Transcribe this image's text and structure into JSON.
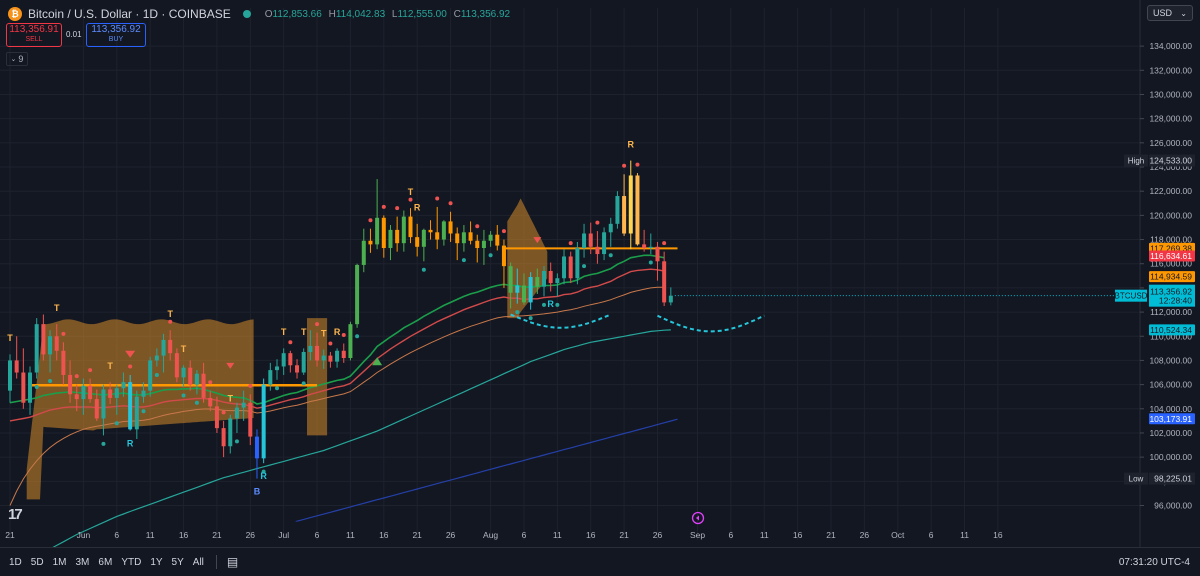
{
  "header": {
    "symbol_title": "Bitcoin / U.S. Dollar · 1D · COINBASE",
    "coin_glyph": "₿",
    "ohlc": [
      {
        "k": "O",
        "v": "112,853.66"
      },
      {
        "k": "H",
        "v": "114,042.83"
      },
      {
        "k": "L",
        "v": "112,555.00"
      },
      {
        "k": "C",
        "v": "113,356.92"
      }
    ]
  },
  "trade": {
    "sell_price": "113,356.91",
    "sell_label": "SELL",
    "spread": "0.01",
    "buy_price": "113,356.92",
    "buy_label": "BUY"
  },
  "indicator_toggle": "9",
  "currency": "USD",
  "axis_badges": [
    {
      "text": "117,269.38",
      "value": 117269.38,
      "bg": "#ff9800",
      "fg": "#131722"
    },
    {
      "text": "116,634.61",
      "value": 116634.61,
      "bg": "#f23645",
      "fg": "#ffffff"
    },
    {
      "text": "114,934.59",
      "value": 114934.59,
      "bg": "#ff9800",
      "fg": "#131722"
    },
    {
      "text": "110,524.34",
      "value": 110524.34,
      "bg": "#00bcd4",
      "fg": "#131722"
    },
    {
      "text": "103,173.91",
      "value": 103173.91,
      "bg": "#2962ff",
      "fg": "#ffffff"
    }
  ],
  "last_price": {
    "symbol": "BTCUSD",
    "price": "113,356.92",
    "countdown": "12:28:40",
    "value": 113356.92
  },
  "high_marker": {
    "label": "High",
    "text": "124,533.00",
    "value": 124533
  },
  "low_marker": {
    "label": "Low",
    "text": "98,225.01",
    "value": 98225.01
  },
  "bottom": {
    "ranges": [
      "1D",
      "5D",
      "1M",
      "3M",
      "6M",
      "YTD",
      "1Y",
      "5Y",
      "All"
    ],
    "time": "07:31:20 UTC-4"
  },
  "markers": [
    {
      "t": "T",
      "i": 0,
      "above": true,
      "color": "#ffb74d"
    },
    {
      "t": "T",
      "i": 7,
      "above": true,
      "color": "#ffb74d"
    },
    {
      "t": "T",
      "i": 15,
      "above": true,
      "color": "#ffb74d"
    },
    {
      "t": "T",
      "i": 24,
      "above": true,
      "color": "#ffb74d"
    },
    {
      "t": "T",
      "i": 26,
      "above": true,
      "color": "#ffb74d"
    },
    {
      "t": "T",
      "i": 33,
      "above": true,
      "color": "#ffb74d"
    },
    {
      "t": "R",
      "i": 18,
      "above": false,
      "color": "#26c6da"
    },
    {
      "t": "B",
      "i": 37,
      "above": false,
      "color": "#5b8cff"
    },
    {
      "t": "R",
      "i": 38,
      "above": false,
      "color": "#26c6da"
    },
    {
      "t": "T",
      "i": 41,
      "above": true,
      "color": "#ffb74d"
    },
    {
      "t": "T",
      "i": 44,
      "above": true,
      "color": "#ffb74d"
    },
    {
      "t": "T",
      "i": 47,
      "above": true,
      "color": "#ffb74d"
    },
    {
      "t": "R",
      "i": 49,
      "above": true,
      "color": "#ffb74d"
    },
    {
      "t": "T",
      "i": 60,
      "above": true,
      "color": "#ffb74d"
    },
    {
      "t": "R",
      "i": 61,
      "above": true,
      "color": "#ffb74d"
    },
    {
      "t": "R",
      "i": 81,
      "above": false,
      "color": "#26c6da"
    },
    {
      "t": "R",
      "i": 93,
      "above": true,
      "color": "#ffb74d"
    }
  ],
  "chart_data": {
    "type": "candlestick",
    "y_axis": {
      "ticks": [
        96000,
        98000,
        100000,
        102000,
        104000,
        106000,
        108000,
        110000,
        112000,
        114000,
        116000,
        118000,
        120000,
        122000,
        124000,
        126000,
        128000,
        130000,
        132000,
        134000
      ],
      "tick_labels": [
        "96,000.00",
        "98,000.00",
        "100,000.00",
        "102,000.00",
        "104,000.00",
        "106,000.00",
        "108,000.00",
        "110,000.00",
        "112,000.00",
        "114,000.00",
        "116,000.00",
        "118,000.00",
        "120,000.00",
        "122,000.00",
        "124,000.00",
        "126,000.00",
        "128,000.00",
        "130,000.00",
        "132,000.00",
        "134,000.00"
      ],
      "range": [
        94800,
        135500
      ]
    },
    "x_axis": {
      "labels": [
        {
          "t": "21",
          "d": 0
        },
        {
          "t": "Jun",
          "d": 11
        },
        {
          "t": "6",
          "d": 16
        },
        {
          "t": "11",
          "d": 21
        },
        {
          "t": "16",
          "d": 26
        },
        {
          "t": "21",
          "d": 31
        },
        {
          "t": "26",
          "d": 36
        },
        {
          "t": "Jul",
          "d": 41
        },
        {
          "t": "6",
          "d": 46
        },
        {
          "t": "11",
          "d": 51
        },
        {
          "t": "16",
          "d": 56
        },
        {
          "t": "21",
          "d": 61
        },
        {
          "t": "26",
          "d": 66
        },
        {
          "t": "Aug",
          "d": 72
        },
        {
          "t": "6",
          "d": 77
        },
        {
          "t": "11",
          "d": 82
        },
        {
          "t": "16",
          "d": 87
        },
        {
          "t": "21",
          "d": 92
        },
        {
          "t": "26",
          "d": 97
        },
        {
          "t": "Sep",
          "d": 103
        },
        {
          "t": "6",
          "d": 108
        },
        {
          "t": "11",
          "d": 113
        },
        {
          "t": "16",
          "d": 118
        },
        {
          "t": "21",
          "d": 123
        },
        {
          "t": "26",
          "d": 128
        },
        {
          "t": "Oct",
          "d": 133
        },
        {
          "t": "6",
          "d": 138
        },
        {
          "t": "11",
          "d": 143
        },
        {
          "t": "16",
          "d": 148
        }
      ]
    },
    "candles": [
      [
        105500,
        108500,
        104500,
        108000
      ],
      [
        108000,
        110000,
        106500,
        107000
      ],
      [
        107000,
        109000,
        104000,
        104500
      ],
      [
        104500,
        107500,
        103500,
        107000
      ],
      [
        107000,
        111500,
        106500,
        111000
      ],
      [
        111000,
        111800,
        108000,
        108500
      ],
      [
        108500,
        110500,
        107000,
        110000
      ],
      [
        110000,
        111000,
        108000,
        108800
      ],
      [
        108800,
        109500,
        106000,
        106800
      ],
      [
        106800,
        108000,
        104500,
        105200
      ],
      [
        105200,
        106000,
        103800,
        104800
      ],
      [
        104800,
        106500,
        103500,
        105900
      ],
      [
        105900,
        106500,
        104500,
        104800
      ],
      [
        104800,
        105600,
        103000,
        103200
      ],
      [
        103200,
        106000,
        101800,
        105600
      ],
      [
        105600,
        106200,
        104400,
        104900
      ],
      [
        104900,
        106000,
        103500,
        105700
      ],
      [
        105700,
        107000,
        105000,
        106200
      ],
      [
        106200,
        106800,
        102200,
        102300
      ],
      [
        102300,
        105500,
        101500,
        105000
      ],
      [
        105000,
        106200,
        104500,
        105500
      ],
      [
        105500,
        108300,
        105000,
        108000
      ],
      [
        108000,
        109000,
        107500,
        108400
      ],
      [
        108400,
        110200,
        107000,
        109700
      ],
      [
        109700,
        110500,
        108000,
        108600
      ],
      [
        108600,
        109000,
        106200,
        106600
      ],
      [
        106600,
        107600,
        105800,
        107400
      ],
      [
        107400,
        108000,
        105500,
        106000
      ],
      [
        106000,
        107200,
        105200,
        106900
      ],
      [
        106900,
        107800,
        104500,
        104900
      ],
      [
        104900,
        105500,
        103800,
        104200
      ],
      [
        104200,
        105000,
        102000,
        102400
      ],
      [
        102400,
        103000,
        100000,
        100900
      ],
      [
        100900,
        103500,
        100300,
        103200
      ],
      [
        103200,
        104500,
        102000,
        104100
      ],
      [
        104100,
        105500,
        103000,
        104500
      ],
      [
        104500,
        105200,
        101000,
        101700
      ],
      [
        101700,
        102300,
        98225,
        99900
      ],
      [
        99900,
        106500,
        99500,
        106000
      ],
      [
        106000,
        107800,
        105500,
        107200
      ],
      [
        107200,
        108100,
        106400,
        107500
      ],
      [
        107500,
        109000,
        106800,
        108600
      ],
      [
        108600,
        108800,
        107000,
        107600
      ],
      [
        107600,
        108100,
        106500,
        107000
      ],
      [
        107000,
        109000,
        106800,
        108700
      ],
      [
        108700,
        110500,
        108000,
        109200
      ],
      [
        109200,
        110300,
        107500,
        108000
      ],
      [
        108000,
        108900,
        107300,
        108400
      ],
      [
        108400,
        108700,
        107400,
        107900
      ],
      [
        107900,
        109000,
        107400,
        108800
      ],
      [
        108800,
        109400,
        107800,
        108200
      ],
      [
        108200,
        111200,
        108000,
        111000
      ],
      [
        111000,
        116000,
        110700,
        115900
      ],
      [
        115900,
        118900,
        115300,
        117900
      ],
      [
        117900,
        118900,
        116900,
        117600
      ],
      [
        117600,
        123000,
        117200,
        119800
      ],
      [
        119800,
        120000,
        116500,
        117300
      ],
      [
        117300,
        119200,
        116300,
        118800
      ],
      [
        118800,
        119900,
        117000,
        117700
      ],
      [
        117700,
        120400,
        117000,
        119900
      ],
      [
        119900,
        120600,
        117700,
        118200
      ],
      [
        118200,
        119300,
        116600,
        117400
      ],
      [
        117400,
        118900,
        116200,
        118800
      ],
      [
        118800,
        119600,
        118000,
        118600
      ],
      [
        118600,
        120700,
        117200,
        118000
      ],
      [
        118000,
        119600,
        117500,
        119500
      ],
      [
        119500,
        120300,
        117800,
        118500
      ],
      [
        118500,
        119000,
        116300,
        117700
      ],
      [
        117700,
        119200,
        117000,
        118600
      ],
      [
        118600,
        119500,
        117600,
        117900
      ],
      [
        117900,
        118400,
        116100,
        117300
      ],
      [
        117300,
        118800,
        115900,
        117900
      ],
      [
        117900,
        118700,
        117400,
        118400
      ],
      [
        118400,
        119200,
        117100,
        117500
      ],
      [
        117500,
        118000,
        114000,
        115800
      ],
      [
        115800,
        116100,
        112300,
        113600
      ],
      [
        113600,
        115600,
        112700,
        114200
      ],
      [
        114200,
        115200,
        112600,
        112800
      ],
      [
        112800,
        115300,
        112200,
        114900
      ],
      [
        114900,
        115600,
        113500,
        114100
      ],
      [
        114100,
        115800,
        113300,
        115400
      ],
      [
        115400,
        116100,
        113700,
        114400
      ],
      [
        114400,
        115200,
        113300,
        114800
      ],
      [
        114800,
        117200,
        114300,
        116600
      ],
      [
        116600,
        117000,
        114400,
        114800
      ],
      [
        114800,
        117800,
        114300,
        117300
      ],
      [
        117300,
        119300,
        116500,
        118500
      ],
      [
        118500,
        119400,
        116800,
        117400
      ],
      [
        117400,
        118700,
        116000,
        116800
      ],
      [
        116800,
        119000,
        116300,
        118600
      ],
      [
        118600,
        119800,
        117400,
        119300
      ],
      [
        119300,
        122000,
        118900,
        121600
      ],
      [
        121600,
        123400,
        118300,
        118500
      ],
      [
        118500,
        124533,
        117200,
        123300
      ],
      [
        123300,
        123500,
        117500,
        117600
      ],
      [
        117600,
        118800,
        117000,
        117300
      ],
      [
        117300,
        118500,
        116800,
        117400
      ],
      [
        117400,
        117800,
        114600,
        116200
      ],
      [
        116200,
        117000,
        112500,
        112800
      ],
      [
        112800,
        114042,
        112555,
        113356
      ]
    ],
    "ema_green": [
      104500,
      104600,
      104700,
      104800,
      104900,
      105100,
      105200,
      105300,
      105350,
      105400,
      105350,
      105300,
      105250,
      105200,
      105150,
      105200,
      105250,
      105300,
      105200,
      105150,
      105150,
      105250,
      105400,
      105550,
      105600,
      105600,
      105650,
      105650,
      105700,
      105600,
      105450,
      105300,
      105100,
      105000,
      104950,
      104900,
      104700,
      104400,
      104500,
      104700,
      104900,
      105100,
      105250,
      105350,
      105550,
      105750,
      105900,
      106050,
      106200,
      106350,
      106450,
      106700,
      107300,
      107900,
      108450,
      109150,
      109550,
      109950,
      110300,
      110700,
      111000,
      111300,
      111650,
      111950,
      112250,
      112550,
      112800,
      113050,
      113300,
      113500,
      113650,
      113850,
      114050,
      114200,
      114300,
      114200,
      114200,
      114050,
      114100,
      114100,
      114200,
      114200,
      114250,
      114450,
      114500,
      114650,
      114950,
      115100,
      115200,
      115400,
      115600,
      115950,
      116200,
      116500,
      116600,
      116700,
      116700,
      116600,
      116500
    ],
    "ema_red": [
      103000,
      103100,
      103200,
      103300,
      103500,
      103700,
      103900,
      104000,
      104100,
      104150,
      104150,
      104150,
      104150,
      104100,
      104100,
      104150,
      104200,
      104250,
      104200,
      104150,
      104150,
      104250,
      104400,
      104550,
      104650,
      104700,
      104750,
      104800,
      104850,
      104850,
      104800,
      104700,
      104550,
      104450,
      104400,
      104350,
      104250,
      104050,
      104150,
      104300,
      104450,
      104600,
      104750,
      104850,
      105000,
      105200,
      105350,
      105500,
      105650,
      105800,
      105900,
      106100,
      106600,
      107100,
      107600,
      108150,
      108550,
      108950,
      109300,
      109650,
      110000,
      110300,
      110600,
      110900,
      111200,
      111450,
      111700,
      111950,
      112200,
      112400,
      112600,
      112800,
      113000,
      113150,
      113250,
      113150,
      113150,
      113050,
      113100,
      113100,
      113200,
      113250,
      113300,
      113450,
      113500,
      113650,
      113900,
      114050,
      114150,
      114350,
      114550,
      114850,
      115100,
      115350,
      115450,
      115500,
      115550,
      115500,
      115400
    ],
    "ema_orange": [
      96000,
      97200,
      98200,
      99000,
      99700,
      100300,
      100800,
      101200,
      101550,
      101850,
      102100,
      102300,
      102450,
      102550,
      102650,
      102750,
      102850,
      102950,
      102980,
      103000,
      103050,
      103150,
      103300,
      103450,
      103580,
      103680,
      103780,
      103860,
      103940,
      103980,
      103980,
      103950,
      103880,
      103850,
      103850,
      103850,
      103800,
      103650,
      103720,
      103820,
      103950,
      104080,
      104200,
      104300,
      104440,
      104600,
      104720,
      104850,
      104980,
      105110,
      105230,
      105420,
      105800,
      106200,
      106580,
      107000,
      107350,
      107700,
      108020,
      108340,
      108640,
      108920,
      109180,
      109450,
      109700,
      109950,
      110180,
      110400,
      110620,
      110820,
      111000,
      111180,
      111360,
      111520,
      111620,
      111640,
      111670,
      111690,
      111740,
      111790,
      111850,
      111920,
      112000,
      112110,
      112200,
      112320,
      112480,
      112610,
      112730,
      112870,
      113020,
      113230,
      113420,
      113630,
      113770,
      113890,
      114000,
      114050,
      114060
    ],
    "ma_cyan": [
      91800,
      92100,
      92400,
      92700,
      93000,
      93300,
      93600,
      93850,
      94100,
      94350,
      94600,
      94850,
      95100,
      95300,
      95500,
      95700,
      95900,
      96100,
      96300,
      96500,
      96700,
      96900,
      97100,
      97300,
      97500,
      97700,
      97900,
      98100,
      98300,
      98450,
      98600,
      98750,
      98900,
      99050,
      99200,
      99350,
      99500,
      99650,
      99800,
      99950,
      100100,
      100250,
      100400,
      100550,
      100750,
      100950,
      101150,
      101350,
      101550,
      101750,
      101950,
      102150,
      102400,
      102650,
      102900,
      103150,
      103400,
      103650,
      103900,
      104150,
      104400,
      104650,
      104900,
      105150,
      105400,
      105650,
      105900,
      106150,
      106400,
      106650,
      106900,
      107150,
      107400,
      107650,
      107900,
      108100,
      108300,
      108500,
      108700,
      108900,
      109050,
      109200,
      109350,
      109500,
      109600,
      109700,
      109800,
      109900,
      110000,
      110100,
      110200,
      110300,
      110400,
      110450,
      110500,
      110524
    ]
  }
}
